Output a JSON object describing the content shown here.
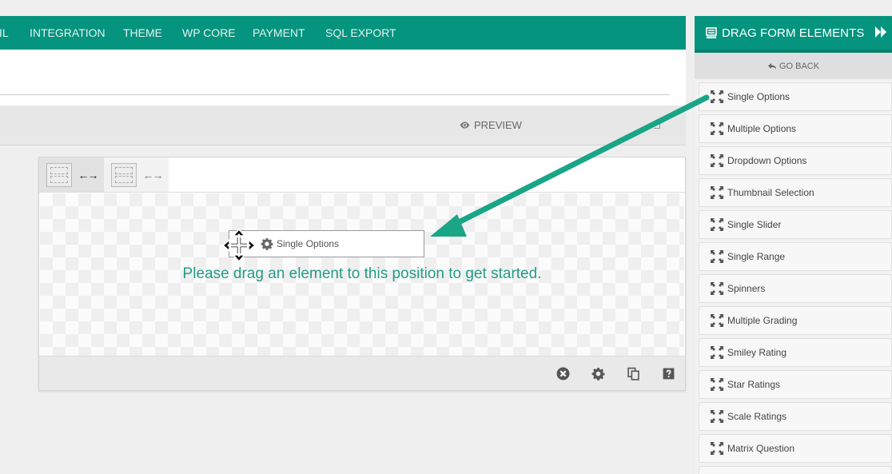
{
  "nav": {
    "tabs": [
      {
        "label": "IL"
      },
      {
        "label": "INTEGRATION"
      },
      {
        "label": "THEME"
      },
      {
        "label": "WP CORE"
      },
      {
        "label": "PAYMENT"
      },
      {
        "label": "SQL EXPORT"
      }
    ],
    "accent": "#05947e"
  },
  "toolbar": {
    "preview_label": "PREVIEW"
  },
  "builder": {
    "layout_tabs": [
      {
        "icon": "layout-grid-icon",
        "arrows": "←→",
        "active": true
      },
      {
        "icon": "layout-grid-icon",
        "arrows": "←→",
        "active": false
      }
    ],
    "drop_message": "Please drag an element to this position to get started.",
    "dragging_label": "Single Options",
    "footer_icons": [
      "delete-icon",
      "settings-icon",
      "duplicate-icon",
      "help-icon"
    ]
  },
  "sidebar": {
    "title": "DRAG FORM ELEMENTS",
    "go_back": "GO BACK",
    "items": [
      {
        "label": "Single Options"
      },
      {
        "label": "Multiple Options"
      },
      {
        "label": "Dropdown Options"
      },
      {
        "label": "Thumbnail Selection"
      },
      {
        "label": "Single Slider"
      },
      {
        "label": "Single Range"
      },
      {
        "label": "Spinners"
      },
      {
        "label": "Multiple Grading"
      },
      {
        "label": "Smiley Rating"
      },
      {
        "label": "Star Ratings"
      },
      {
        "label": "Scale Ratings"
      },
      {
        "label": "Matrix Question"
      },
      {
        "label": ""
      }
    ]
  },
  "colors": {
    "accent": "#05947e",
    "message": "#239b86",
    "arrow": "#1aa587"
  }
}
